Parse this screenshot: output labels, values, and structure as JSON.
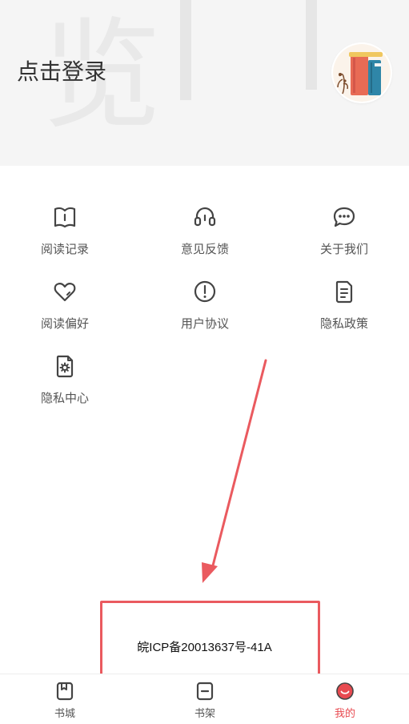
{
  "header": {
    "login_label": "点击登录",
    "watermark_char": "览"
  },
  "menu": {
    "items": [
      {
        "label": "阅读记录",
        "icon": "book-open-icon"
      },
      {
        "label": "意见反馈",
        "icon": "headset-icon"
      },
      {
        "label": "关于我们",
        "icon": "chat-bubble-icon"
      },
      {
        "label": "阅读偏好",
        "icon": "heart-icon"
      },
      {
        "label": "用户协议",
        "icon": "exclamation-circle-icon"
      },
      {
        "label": "隐私政策",
        "icon": "document-lines-icon"
      },
      {
        "label": "隐私中心",
        "icon": "document-gear-icon"
      }
    ]
  },
  "footer": {
    "icp": "皖ICP备20013637号-41A"
  },
  "tabbar": {
    "tabs": [
      {
        "label": "书城",
        "icon": "bookmark-book-icon",
        "active": false
      },
      {
        "label": "书架",
        "icon": "bookshelf-icon",
        "active": false
      },
      {
        "label": "我的",
        "icon": "user-face-icon",
        "active": true
      }
    ]
  },
  "colors": {
    "accent": "#e84a50",
    "annotation": "#ea5a5f",
    "header_bg": "#f5f5f5",
    "icon": "#444444"
  }
}
